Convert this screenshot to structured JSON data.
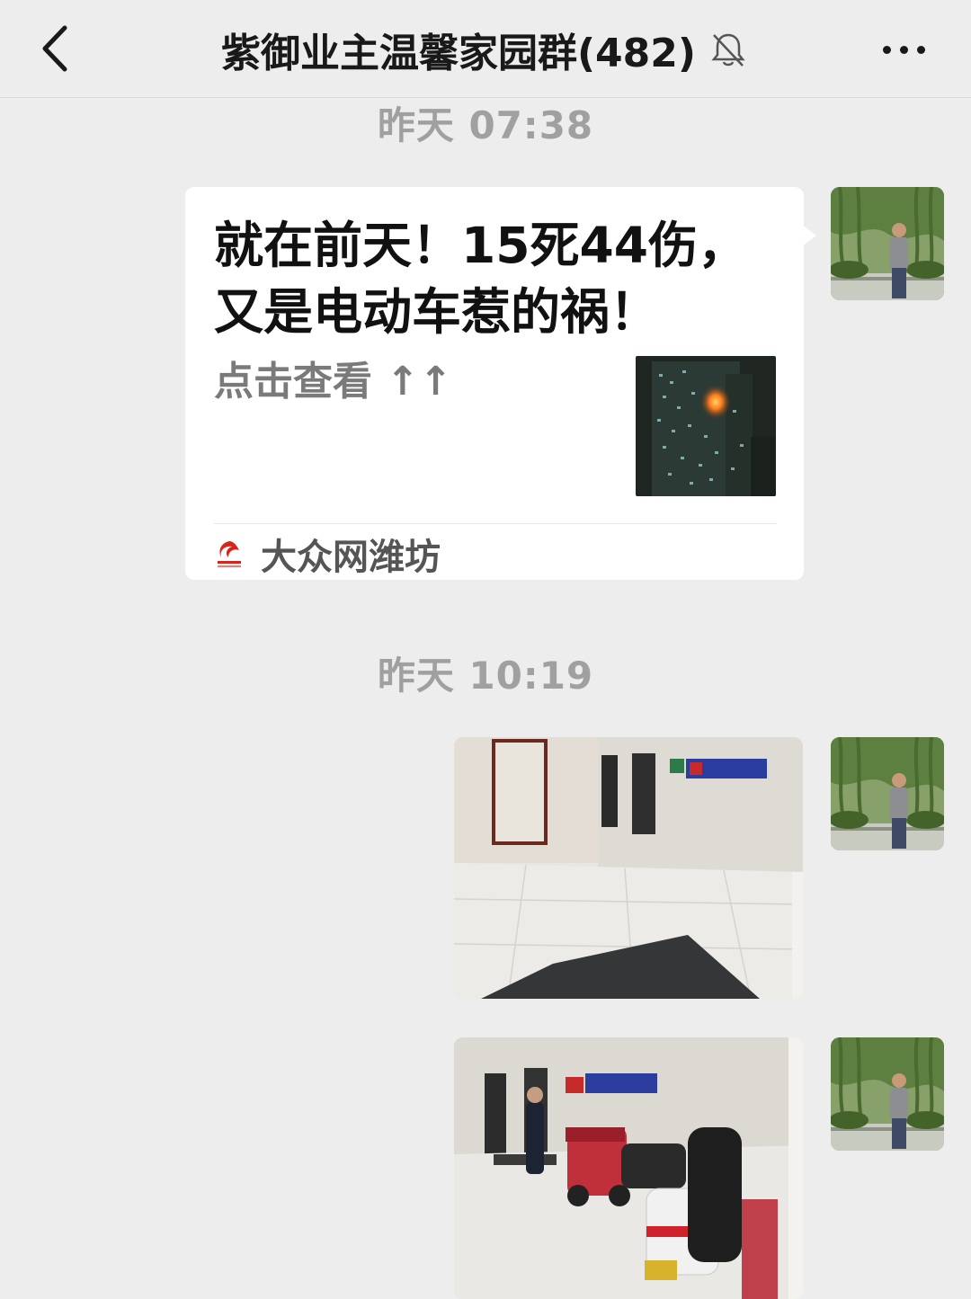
{
  "header": {
    "title": "紫御业主温馨家园群(482)",
    "icons": {
      "back": "chevron-left-icon",
      "mute": "bell-off-icon",
      "more": "more-dots-icon"
    }
  },
  "messages": [
    {
      "time": "昨天 07:38",
      "type": "link-card",
      "title": "就在前天！15死44伤，又是电动车惹的祸！",
      "description": "点击查看 ↑↑",
      "source": "大众网潍坊",
      "thumbnail": "burning-building-photo"
    },
    {
      "time": "昨天 10:19",
      "type": "images",
      "images": [
        "lobby-photo",
        "lobby-ebikes-photo"
      ]
    }
  ],
  "colors": {
    "background": "#ededed",
    "bubble": "#ffffff",
    "time": "#a0a0a0",
    "brand_red": "#d8251c"
  }
}
